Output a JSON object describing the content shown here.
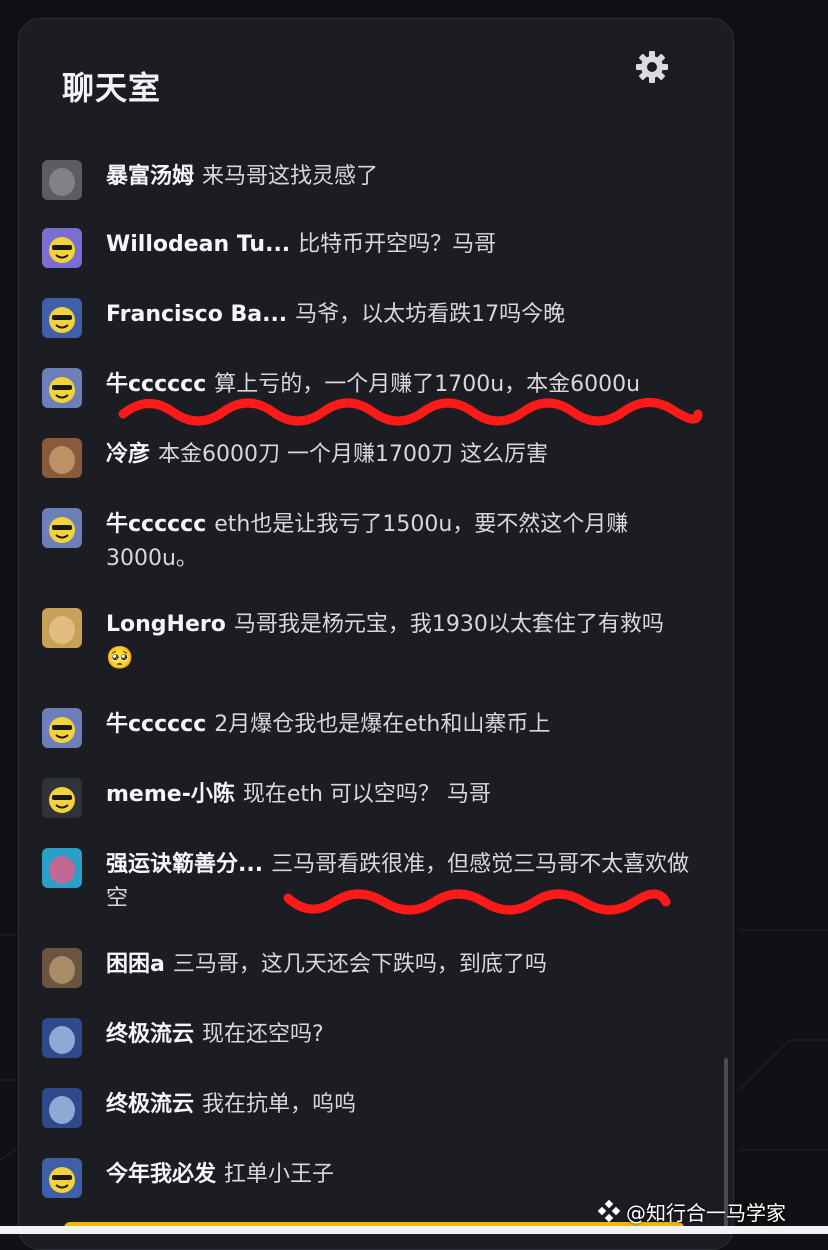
{
  "header": {
    "title": "聊天室",
    "settings_icon": "gear-icon"
  },
  "messages": [
    {
      "user": "暴富汤姆",
      "text": "来马哥这找灵感了",
      "avatar": "gray-square"
    },
    {
      "user": "Willodean Tu...",
      "text": "比特币开空吗？马哥",
      "avatar": "party-face"
    },
    {
      "user": "Francisco Ba...",
      "text": "马爷，以太坊看跌17吗今晚",
      "avatar": "police-face"
    },
    {
      "user": "牛cccccc",
      "text": "算上亏的，一个月赚了1700u，本金6000u",
      "avatar": "sunglasses-face"
    },
    {
      "user": "冷彦",
      "text": "本金6000刀 一个月赚1700刀 这么厉害",
      "avatar": "poster"
    },
    {
      "user": "牛cccccc",
      "text": "eth也是让我亏了1500u，要不然这个月赚3000u。",
      "avatar": "sunglasses-face"
    },
    {
      "user": "LongHero",
      "text": "马哥我是杨元宝，我1930以太套住了有救吗🥺",
      "avatar": "cat"
    },
    {
      "user": "牛cccccc",
      "text": "2月爆仓我也是爆在eth和山寨币上",
      "avatar": "sunglasses-face"
    },
    {
      "user": "meme-小陈",
      "text": "现在eth 可以空吗？ 马哥",
      "avatar": "hat-face"
    },
    {
      "user": "强运诀簕善分...",
      "text": "三马哥看跌很准，但感觉三马哥不太喜欢做空",
      "avatar": "anime"
    },
    {
      "user": "困困a",
      "text": "三马哥，这几天还会下跌吗，到底了吗",
      "avatar": "dog"
    },
    {
      "user": "终极流云",
      "text": "现在还空吗?",
      "avatar": "blue-art"
    },
    {
      "user": "终极流云",
      "text": "我在抗单，呜呜",
      "avatar": "blue-art"
    },
    {
      "user": "今年我必发",
      "text": "扛单小王子",
      "avatar": "police-face"
    }
  ],
  "watermark": {
    "text": "@知行合一马学家"
  },
  "colors": {
    "panel": "#1b1d22",
    "annotation": "#ff0000",
    "accent": "#f0b90b"
  }
}
